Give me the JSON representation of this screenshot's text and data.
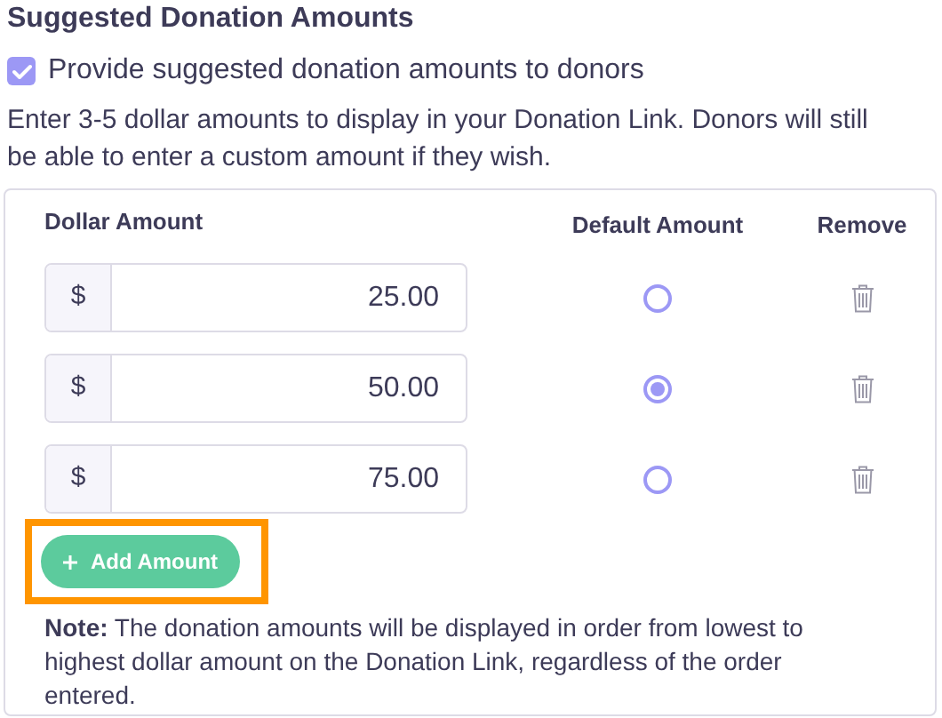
{
  "heading": "Suggested Donation Amounts",
  "provide_checkbox": {
    "label": "Provide suggested donation amounts to donors",
    "checked": true
  },
  "instructions": "Enter 3-5 dollar amounts to display in your Donation Link. Donors will still be able to enter a custom amount if they wish.",
  "table": {
    "columns": [
      "Dollar Amount",
      "Default Amount",
      "Remove"
    ],
    "rows": [
      {
        "prefix": "$",
        "amount": "25.00",
        "selected": false
      },
      {
        "prefix": "$",
        "amount": "50.00",
        "selected": true
      },
      {
        "prefix": "$",
        "amount": "75.00",
        "selected": false
      }
    ]
  },
  "add_button": {
    "label": "Add Amount",
    "highlighted": true
  },
  "note": "**Note:**  The donation amounts will be displayed in order from lowest to highest dollar amount on the Donation Link, regardless of the order entered."
}
